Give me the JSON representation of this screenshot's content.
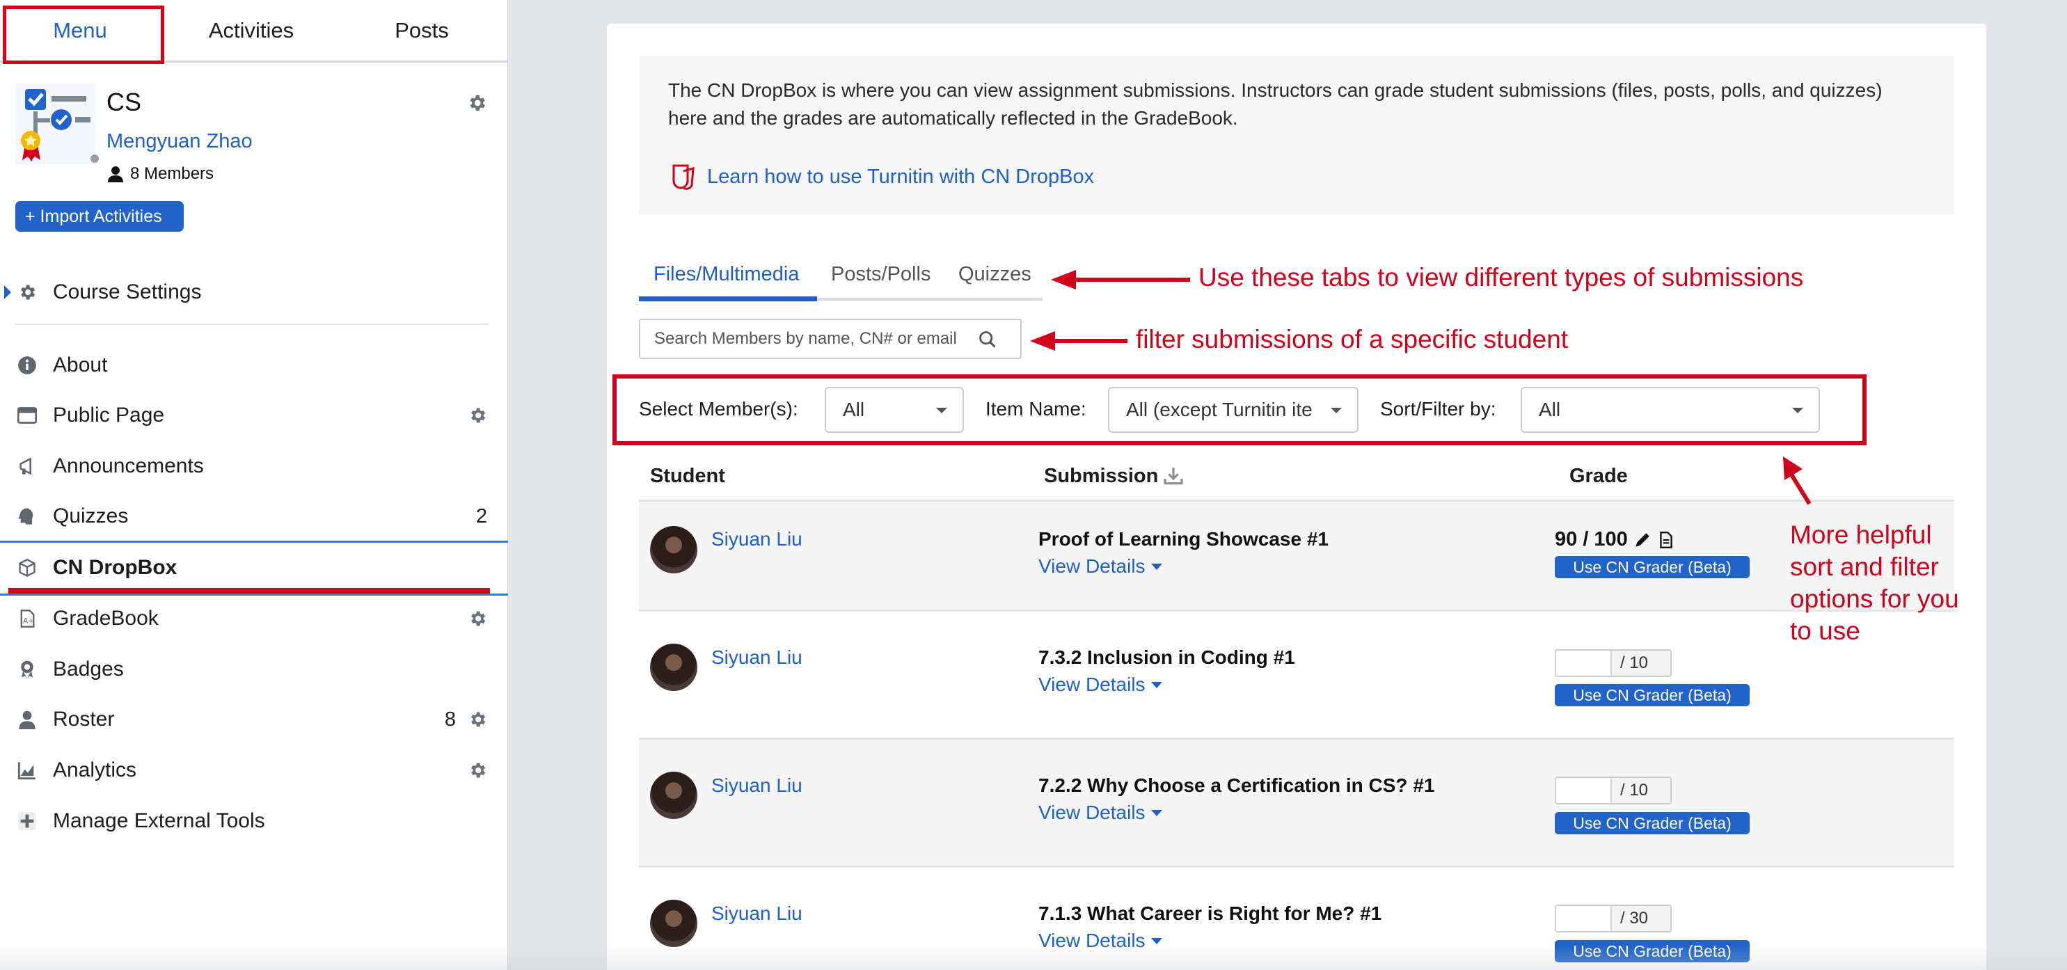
{
  "sidebar": {
    "tabs": [
      {
        "label": "Menu",
        "active": true
      },
      {
        "label": "Activities"
      },
      {
        "label": "Posts"
      }
    ],
    "course": {
      "name": "CS",
      "instructor": "Mengyuan Zhao",
      "members": "8 Members"
    },
    "import_label": "+ Import Activities",
    "nav": [
      {
        "label": "Course Settings",
        "icon": "gear-icon"
      },
      {
        "label": "About",
        "icon": "info-icon"
      },
      {
        "label": "Public Page",
        "icon": "window-icon",
        "gear": true
      },
      {
        "label": "Announcements",
        "icon": "megaphone-icon"
      },
      {
        "label": "Quizzes",
        "icon": "head-icon",
        "count": "2"
      },
      {
        "label": "CN DropBox",
        "icon": "box-icon",
        "active": true
      },
      {
        "label": "GradeBook",
        "icon": "gradebook-icon",
        "gear": true
      },
      {
        "label": "Badges",
        "icon": "badge-icon"
      },
      {
        "label": "Roster",
        "icon": "person-icon",
        "count": "8",
        "gear": true
      },
      {
        "label": "Analytics",
        "icon": "chart-icon",
        "gear": true
      },
      {
        "label": "Manage External Tools",
        "icon": "plus-icon"
      }
    ]
  },
  "main": {
    "info_text": "The CN DropBox is where you can view assignment submissions. Instructors can grade student submissions (files, posts, polls, and quizzes) here and the grades are automatically reflected in the GradeBook.",
    "turnitin_link": "Learn how to use Turnitin with CN DropBox",
    "tabs": [
      {
        "label": "Files/Multimedia",
        "active": true
      },
      {
        "label": "Posts/Polls"
      },
      {
        "label": "Quizzes"
      }
    ],
    "search_placeholder": "Search Members by name, CN# or email",
    "filters": {
      "member_label": "Select Member(s):",
      "member_value": "All",
      "item_label": "Item Name:",
      "item_value": "All (except Turnitin ite",
      "sort_label": "Sort/Filter by:",
      "sort_value": "All"
    },
    "table": {
      "headers": {
        "student": "Student",
        "submission": "Submission",
        "grade": "Grade"
      },
      "view_details": "View Details",
      "grader_label": "Use CN Grader (Beta)",
      "rows": [
        {
          "student": "Siyuan Liu",
          "item": "Proof of Learning Showcase #1",
          "grade": "90 / 100",
          "graded": true
        },
        {
          "student": "Siyuan Liu",
          "item": "7.3.2 Inclusion in Coding #1",
          "max": "/ 10"
        },
        {
          "student": "Siyuan Liu",
          "item": "7.2.2 Why Choose a Certification in CS? #1",
          "max": "/ 10"
        },
        {
          "student": "Siyuan Liu",
          "item": "7.1.3 What Career is Right for Me? #1",
          "max": "/ 30"
        }
      ]
    }
  },
  "annotations": {
    "tabs_note": "Use these tabs to view different types of submissions",
    "search_note": "filter submissions of a specific student",
    "filter_note_lines": [
      "More helpful",
      "sort and filter",
      "options for you",
      "to use"
    ]
  },
  "colors": {
    "accent_blue": "#1f5fc8",
    "annotation_red": "#d0021b"
  }
}
